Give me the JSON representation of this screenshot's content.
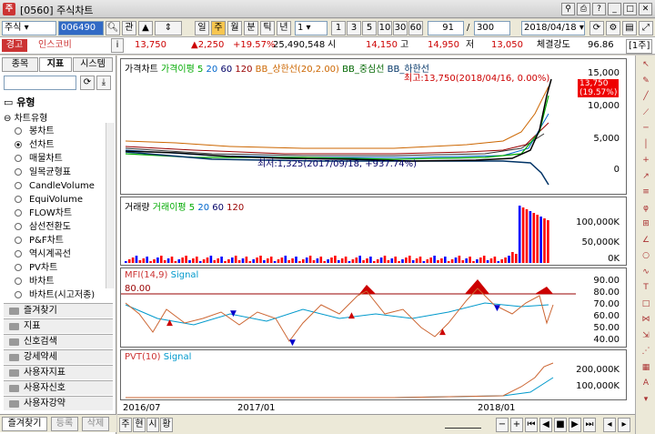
{
  "window": {
    "title": "[0560] 주식차트"
  },
  "toolbar": {
    "market": "주식",
    "code": "006490",
    "check1": "관",
    "periods": [
      "일",
      "주",
      "월",
      "분",
      "틱",
      "년"
    ],
    "count1": "1",
    "quick": [
      "1",
      "3",
      "5",
      "10",
      "30",
      "60"
    ],
    "range_a": "91",
    "range_sep": "/",
    "range_b": "300",
    "date": "2018/04/18"
  },
  "quote": {
    "badge": "경고",
    "name": "인스코비",
    "info": "i",
    "price": "13,750",
    "change": "▲2,250",
    "rate": "+19.57%",
    "volume": "25,490,548",
    "open_label": "시",
    "open": "14,150",
    "high_label": "고",
    "high": "14,950",
    "low_label": "저",
    "low": "13,050",
    "strength_label": "체결강도",
    "strength": "96.86",
    "unit": "[1주]"
  },
  "left": {
    "tabs": [
      "종목",
      "지표",
      "시스템"
    ],
    "section": "유형",
    "group": "차트유형",
    "items": [
      "봉차트",
      "선차트",
      "매물차트",
      "일목균형표",
      "CandleVolume",
      "EquiVolume",
      "FLOW차트",
      "삼선전환도",
      "P&F차트",
      "역시계곡선",
      "PV차트",
      "바차트",
      "바차트(시고저종)"
    ],
    "selected_index": 1,
    "folders": [
      "즐겨찾기",
      "지표",
      "신호검색",
      "강세약세",
      "사용자지표",
      "사용자신호",
      "사용자강약"
    ],
    "bottom_tabs": [
      "즐겨찾기",
      "등록",
      "삭제"
    ]
  },
  "panes": {
    "price": {
      "legend": [
        "가격차트",
        "가격이평 5",
        "20",
        "60",
        "120",
        "BB_상한선(20,2.00)",
        "BB_중심선",
        "BB_하한선"
      ],
      "ticks": [
        "15,000",
        "10,000",
        "5,000",
        "0"
      ],
      "max_note": "최고:13,750(2018/04/16, 0.00%)",
      "min_note": "최저:1,325(2017/09/18, +937.74%)",
      "last_price": "13,750",
      "last_rate": "(19.57%)"
    },
    "volume": {
      "legend": [
        "거래량",
        "거래이평 5",
        "20",
        "60",
        "120"
      ],
      "ticks": [
        "100,000K",
        "50,000K",
        "0K"
      ]
    },
    "mfi": {
      "legend": [
        "MFI(14,9)",
        "Signal"
      ],
      "level": "80.00",
      "ticks": [
        "90.00",
        "80.00",
        "70.00",
        "60.00",
        "50.00",
        "40.00"
      ]
    },
    "pvt": {
      "legend": [
        "PVT(10)",
        "Signal"
      ],
      "ticks": [
        "200,000K",
        "100,000K"
      ]
    },
    "xaxis": [
      "2016/07",
      "2017/01",
      "2018/01"
    ]
  },
  "bottom": {
    "tabs": [
      "주",
      "현",
      "시",
      "황"
    ]
  },
  "colors": {
    "up": "#ff0000",
    "down": "#0000ff",
    "accent": "#cc0000",
    "signal": "#00a0c0"
  }
}
